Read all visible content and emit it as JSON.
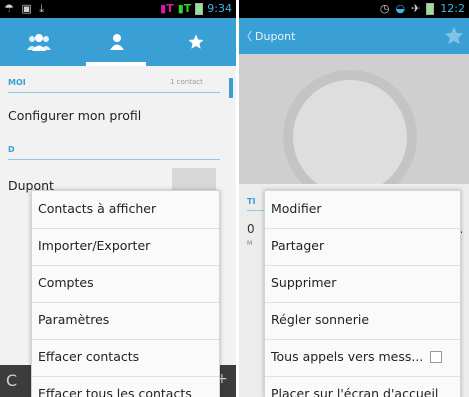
{
  "left": {
    "status": {
      "time": "9:34",
      "left_icons": "☂ ▣ ⤓",
      "sim1": "T",
      "sim2": "T"
    },
    "tabs": [
      {
        "name": "groups",
        "icon": "group-icon"
      },
      {
        "name": "contacts",
        "icon": "person-icon"
      },
      {
        "name": "favorites",
        "icon": "star-icon"
      }
    ],
    "section_moi": {
      "header": "MOI",
      "count": "1 contact"
    },
    "configure_profile": "Configurer mon profil",
    "section_d": {
      "header": "D"
    },
    "contact_name": "Dupont",
    "partial_letter": "C",
    "menu": [
      "Contacts à afficher",
      "Importer/Exporter",
      "Comptes",
      "Paramètres",
      "Effacer contacts",
      "Effacer tous les contacts"
    ]
  },
  "right": {
    "status": {
      "time": "12:2"
    },
    "back_title": "Dupont",
    "partial": {
      "header": "TI",
      "digit": "0",
      "sub": "M",
      "edge": "r"
    },
    "menu": [
      "Modifier",
      "Partager",
      "Supprimer",
      "Régler sonnerie",
      "Tous appels vers mess...",
      "Placer sur l'écran d'accueil"
    ]
  },
  "colors": {
    "accent": "#3a9fd4",
    "status_bar": "#000000",
    "menu_bg": "#fafafa",
    "text": "#222222"
  }
}
